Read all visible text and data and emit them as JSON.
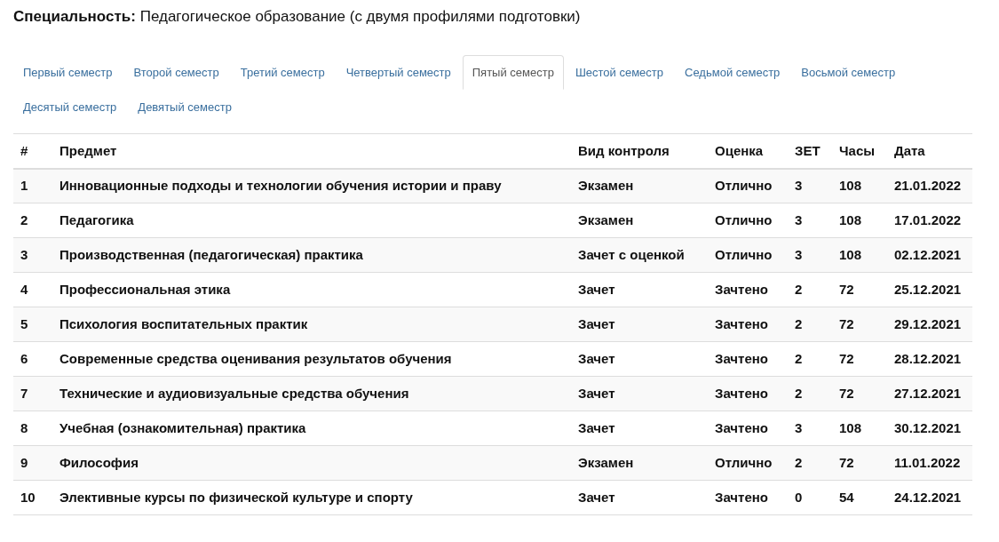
{
  "specialty": {
    "label": "Специальность:",
    "value": "Педагогическое образование (с двумя профилями подготовки)"
  },
  "tabs": [
    {
      "label": "Первый семестр",
      "selected": false
    },
    {
      "label": "Второй семестр",
      "selected": false
    },
    {
      "label": "Третий семестр",
      "selected": false
    },
    {
      "label": "Четвертый семестр",
      "selected": false
    },
    {
      "label": "Пятый семестр",
      "selected": true
    },
    {
      "label": "Шестой семестр",
      "selected": false
    },
    {
      "label": "Седьмой семестр",
      "selected": false
    },
    {
      "label": "Восьмой семестр",
      "selected": false
    },
    {
      "label": "Десятый семестр",
      "selected": false
    },
    {
      "label": "Девятый семестр",
      "selected": false
    }
  ],
  "table": {
    "columns": [
      "#",
      "Предмет",
      "Вид контроля",
      "Оценка",
      "ЗЕТ",
      "Часы",
      "Дата"
    ],
    "rows": [
      [
        "1",
        "Инновационные подходы и технологии обучения истории и праву",
        "Экзамен",
        "Отлично",
        "3",
        "108",
        "21.01.2022"
      ],
      [
        "2",
        "Педагогика",
        "Экзамен",
        "Отлично",
        "3",
        "108",
        "17.01.2022"
      ],
      [
        "3",
        "Производственная (педагогическая) практика",
        "Зачет с оценкой",
        "Отлично",
        "3",
        "108",
        "02.12.2021"
      ],
      [
        "4",
        "Профессиональная этика",
        "Зачет",
        "Зачтено",
        "2",
        "72",
        "25.12.2021"
      ],
      [
        "5",
        "Психология воспитательных практик",
        "Зачет",
        "Зачтено",
        "2",
        "72",
        "29.12.2021"
      ],
      [
        "6",
        "Современные средства оценивания результатов обучения",
        "Зачет",
        "Зачтено",
        "2",
        "72",
        "28.12.2021"
      ],
      [
        "7",
        "Технические и аудиовизуальные средства обучения",
        "Зачет",
        "Зачтено",
        "2",
        "72",
        "27.12.2021"
      ],
      [
        "8",
        "Учебная (ознакомительная) практика",
        "Зачет",
        "Зачтено",
        "3",
        "108",
        "30.12.2021"
      ],
      [
        "9",
        "Философия",
        "Экзамен",
        "Отлично",
        "2",
        "72",
        "11.01.2022"
      ],
      [
        "10",
        "Элективные курсы по физической культуре и спорту",
        "Зачет",
        "Зачтено",
        "0",
        "54",
        "24.12.2021"
      ]
    ]
  }
}
